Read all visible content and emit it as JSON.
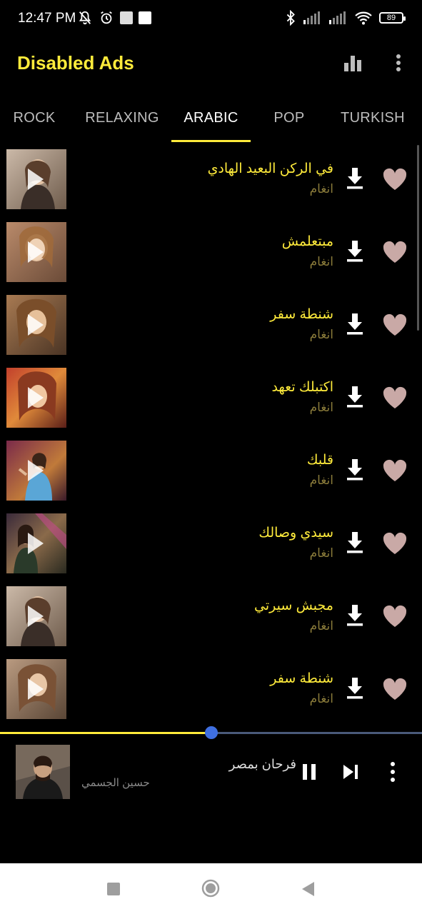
{
  "status_bar": {
    "time": "12:47 PM",
    "battery": "89",
    "icons": [
      "bell-off-icon",
      "alarm-icon",
      "square-icon",
      "square-icon",
      "bluetooth-icon",
      "signal-icon",
      "signal-icon",
      "wifi-icon",
      "battery-icon"
    ]
  },
  "app_bar": {
    "title": "Disabled Ads",
    "icons": [
      "bar-chart-icon",
      "more-vert-icon"
    ]
  },
  "tabs": [
    {
      "label": "ROCK",
      "active": false
    },
    {
      "label": "RELAXING",
      "active": false
    },
    {
      "label": "ARABIC",
      "active": true
    },
    {
      "label": "POP",
      "active": false
    },
    {
      "label": "TURKISH",
      "active": false
    }
  ],
  "songs": [
    {
      "title": "في الركن البعيد الهادي",
      "artist": "انغام"
    },
    {
      "title": "مبتعلمش",
      "artist": "انغام"
    },
    {
      "title": "شنطة سفر",
      "artist": "انغام"
    },
    {
      "title": "اكتبلك تعهد",
      "artist": "انغام"
    },
    {
      "title": "قلبك",
      "artist": "انغام"
    },
    {
      "title": "سيدي وصالك",
      "artist": "انغام"
    },
    {
      "title": "مجبش سيرتي",
      "artist": "انغام"
    },
    {
      "title": "شنطة سفر",
      "artist": "انغام"
    }
  ],
  "player": {
    "title": "فرحان بمصر",
    "artist": "حسين الجسمي",
    "progress": 0.5,
    "controls": [
      "pause-icon",
      "skip-next-icon",
      "more-vert-icon"
    ]
  },
  "colors": {
    "accent": "#ffeb3b",
    "artist_text": "#8a7b3a",
    "heart": "#c9a9a6",
    "progress_knob": "#3f6fe0",
    "background": "#000000"
  }
}
